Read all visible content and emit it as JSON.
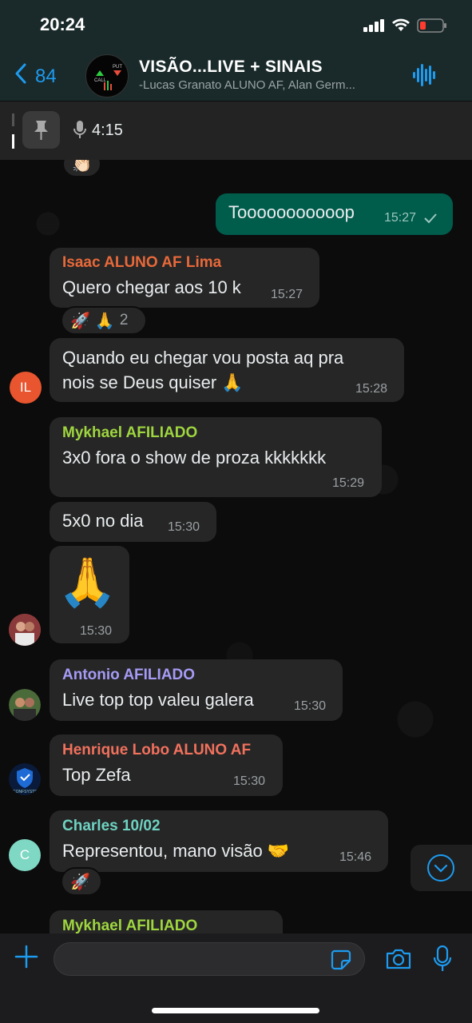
{
  "status_bar": {
    "time": "20:24"
  },
  "header": {
    "back_count": "84",
    "title": "VISÃO...LIVE + SINAIS",
    "subtitle": "-Lucas Granato ALUNO AF, Alan Germ...",
    "avatar_call": "CALL",
    "avatar_put": "PUT",
    "icons": [
      "back-chevron-icon",
      "audio-wave-icon"
    ]
  },
  "pinned": {
    "duration": "4:15",
    "icons": [
      "pin-icon",
      "mic-icon"
    ]
  },
  "messages": [
    {
      "direction": "out",
      "text": "Tooooooooooop",
      "time": "15:27"
    },
    {
      "sender": "Isaac ALUNO AF Lima",
      "sender_color": "#e8693a",
      "text": "Quero chegar aos 10 k",
      "time": "15:27",
      "reactions": [
        "🚀",
        "🙏"
      ],
      "reaction_count": "2"
    },
    {
      "text_line1": "Quando eu chegar vou posta aq pra",
      "text_line2": "nois se Deus quiser 🙏",
      "time": "15:28",
      "avatar_initials": "IL"
    },
    {
      "sender": "Mykhael AFILIADO",
      "sender_color": "#9fd63f",
      "text": "3x0 fora o show de proza kkkkkkk",
      "time": "15:29"
    },
    {
      "text": "5x0 no dia",
      "time": "15:30"
    },
    {
      "emoji": "🙏",
      "time": "15:30"
    },
    {
      "sender": "Antonio AFILIADO",
      "sender_color": "#a59bf5",
      "text": "Live top top valeu galera",
      "time": "15:30"
    },
    {
      "sender": "Henrique Lobo ALUNO AF",
      "sender_color": "#f1715d",
      "text": "Top Zefa",
      "time": "15:30",
      "avatar_label": "CONFSYSTEM"
    },
    {
      "sender": "Charles 10/02",
      "sender_color": "#6fd3c2",
      "text": "Representou, mano visão 🤝",
      "time": "15:46",
      "reactions": [
        "🚀"
      ],
      "avatar_initials": "C"
    },
    {
      "sender": "Mykhael AFILIADO",
      "sender_color": "#9fd63f"
    }
  ],
  "top_reaction": "👏🏻",
  "input": {
    "placeholder": ""
  },
  "colors": {
    "accent": "#1d9bf0",
    "outgoing": "#005c4b",
    "incoming": "#262626"
  }
}
